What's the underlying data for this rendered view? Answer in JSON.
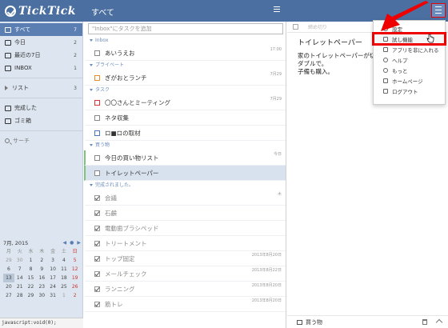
{
  "header": {
    "app_name": "TickTick",
    "view_title": "すべて"
  },
  "sidebar": {
    "items": [
      {
        "label": "すべて",
        "count": "7",
        "active": true
      },
      {
        "label": "今日",
        "count": "2"
      },
      {
        "label": "最近の7日",
        "count": "2"
      },
      {
        "label": "INBOX",
        "count": "1"
      }
    ],
    "list_label": "リスト",
    "list_count": "3",
    "completed_label": "完成した",
    "trash_label": "ゴミ箱",
    "search_label": "サーチ"
  },
  "calendar": {
    "month_label": "7月, 2015",
    "nav": {
      "prev": "◀",
      "today": "●",
      "next": "▶"
    },
    "weekdays": [
      "月",
      "火",
      "水",
      "木",
      "金",
      "土",
      "日"
    ],
    "rows": [
      [
        "29",
        "30",
        "1",
        "2",
        "3",
        "4",
        "5"
      ],
      [
        "6",
        "7",
        "8",
        "9",
        "10",
        "11",
        "12"
      ],
      [
        "13",
        "14",
        "15",
        "16",
        "17",
        "18",
        "19"
      ],
      [
        "20",
        "21",
        "22",
        "23",
        "24",
        "25",
        "26"
      ],
      [
        "27",
        "28",
        "29",
        "30",
        "31",
        "1",
        "2"
      ]
    ]
  },
  "statusbar": {
    "text": "javascript:void(0);"
  },
  "tasklist": {
    "add_placeholder": "\"Inbox\"にタスクを追加",
    "groups": [
      {
        "name": "Inbox",
        "tasks": [
          {
            "title": "あいうえお",
            "meta": "17:00"
          }
        ]
      },
      {
        "name": "プライベート",
        "tasks": [
          {
            "title": "ぎがおとランチ",
            "meta": "7月29"
          }
        ]
      },
      {
        "name": "タスク",
        "tasks": [
          {
            "title": "〇〇さんとミーティング",
            "meta": "7月29"
          },
          {
            "title": "ネタ収集",
            "meta": ""
          },
          {
            "title": "ロ■ロの取材",
            "meta": ""
          }
        ]
      },
      {
        "name": "買う物",
        "tasks": [
          {
            "title": "今日の買い物リスト",
            "meta": "今日"
          },
          {
            "title": "トイレットペーパー",
            "meta": ""
          }
        ]
      },
      {
        "name": "完成されました。",
        "tasks": [
          {
            "title": "会議",
            "meta": "木"
          },
          {
            "title": "石鹸",
            "meta": ""
          },
          {
            "title": "電動歯ブラシペッド",
            "meta": ""
          },
          {
            "title": "トリートメント",
            "meta": ""
          },
          {
            "title": "トップ固定",
            "meta": "2013年8月20日"
          },
          {
            "title": "メールチェック",
            "meta": "2013年8月22日"
          },
          {
            "title": "ランニング",
            "meta": "2013年8月20日"
          },
          {
            "title": "筋トレ",
            "meta": "2013年8月20日"
          }
        ]
      }
    ]
  },
  "detail": {
    "toolbar_label": "締め切り",
    "title": "トイレットペーパー",
    "body": "家のトイレットペーパーが切\nダブルで。\n子備も購入。",
    "footer_list": "買う物"
  },
  "menu": {
    "items": [
      "設定",
      "試し機能",
      "アプリを非に入れる",
      "ヘルプ",
      "もっと",
      "ホームページ",
      "ログアウト"
    ]
  },
  "colors": {
    "header": "#4a6fa0",
    "sidebar": "#dde6f0",
    "accent": "#5b7eb3",
    "highlight": "#ee0000"
  }
}
